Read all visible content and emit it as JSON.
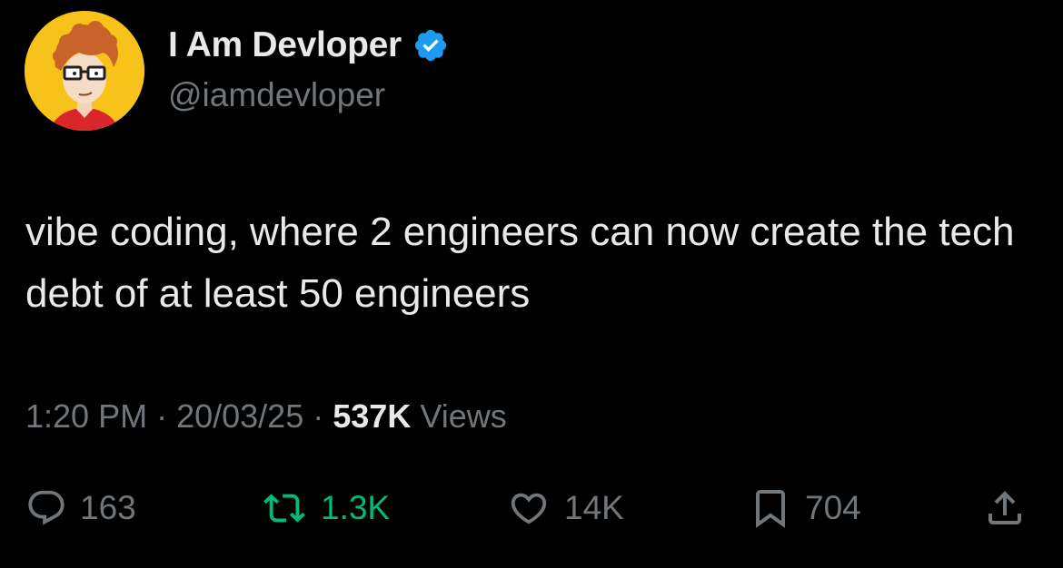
{
  "author": {
    "name": "I Am Devloper",
    "handle": "@iamdevloper",
    "verified": true
  },
  "tweet": {
    "text": "vibe coding, where 2 engineers can now create the tech debt of at least 50 engineers",
    "time": "1:20 PM",
    "date": "20/03/25",
    "views_count": "537K",
    "views_label": "Views"
  },
  "actions": {
    "replies": "163",
    "reposts": "1.3K",
    "likes": "14K",
    "bookmarks": "704"
  },
  "colors": {
    "background": "#000000",
    "text_primary": "#e7e9ea",
    "text_secondary": "#71767b",
    "repost_active": "#00ba7c",
    "verified_badge": "#1d9bf0",
    "avatar_background": "#f7c31a"
  }
}
